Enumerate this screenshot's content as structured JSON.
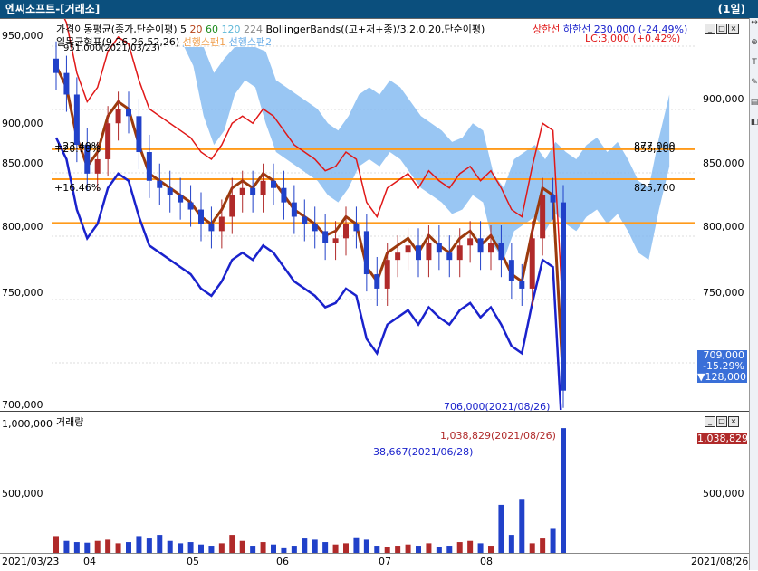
{
  "title": "엔씨소프트-[거래소]",
  "period": "(1일)",
  "legend": {
    "ma_label": "가격이동평균(종가,단순이평)",
    "ma_periods": [
      "5",
      "20",
      "60",
      "120",
      "224"
    ],
    "bb_label": "BollingerBands((고+저+종)/3,2,0,20,단순이평)",
    "upper_limit": "상한선",
    "lower_limit": "하한선",
    "change_info": "230,000 (-24.49%)",
    "ichimoku": "일목균형표(9,26,26,52,26)",
    "leading_span1": "선행스팬1",
    "leading_span2": "선행스팬2",
    "lc": "LC:3,000 (+0.42%)",
    "max_note": "951,000(2021/03/23)"
  },
  "price_axis": {
    "left": [
      "950,000",
      "900,000",
      "850,000",
      "800,000",
      "750,000",
      "700,000"
    ],
    "right": [
      "900,000",
      "850,000",
      "800,000",
      "750,000"
    ]
  },
  "hlines": [
    {
      "pct": "+23.40%",
      "value": "877,000",
      "price": 877000
    },
    {
      "pct": "+20.70%",
      "value": "856,100",
      "price": 856100
    },
    {
      "pct": "+16.46%",
      "value": "825,700",
      "price": 825700
    }
  ],
  "current": {
    "price": "709,000",
    "pct": "-15.29%",
    "change": "▼128,000"
  },
  "min_label": "706,000(2021/08/26)",
  "volume": {
    "title": "거래량",
    "axis": [
      "1,000,000",
      "500,000"
    ],
    "axis_right": [
      "500,000"
    ],
    "max_label": "1,038,829(2021/08/26)",
    "min_label": "38,667(2021/06/28)",
    "current": "1,038,829"
  },
  "dates": {
    "start": "2021/03/23",
    "end": "2021/08/26",
    "months": [
      "04",
      "05",
      "06",
      "07",
      "08"
    ]
  },
  "colors": {
    "up": "#b02a2a",
    "down": "#2141c9",
    "cloud": "#7fb8f0",
    "hline": "#ff9a1a",
    "bb_upper": "#e01818",
    "bb_lower": "#1a22cc",
    "ma20": "#9b3a0c"
  },
  "chart_data": {
    "type": "candlestick",
    "close_approx": [
      930000,
      915000,
      880000,
      860000,
      870000,
      895000,
      905000,
      900000,
      875000,
      855000,
      850000,
      845000,
      840000,
      835000,
      825000,
      820000,
      830000,
      845000,
      850000,
      845000,
      855000,
      850000,
      840000,
      830000,
      825000,
      820000,
      812000,
      815000,
      825000,
      820000,
      790000,
      780000,
      800000,
      805000,
      810000,
      800000,
      812000,
      805000,
      800000,
      810000,
      815000,
      805000,
      812000,
      800000,
      785000,
      780000,
      815000,
      845000,
      840000,
      709000
    ],
    "volume_approx": [
      140000,
      100000,
      90000,
      85000,
      100000,
      110000,
      80000,
      90000,
      140000,
      120000,
      150000,
      100000,
      80000,
      90000,
      70000,
      60000,
      80000,
      150000,
      100000,
      60000,
      90000,
      70000,
      38667,
      60000,
      120000,
      110000,
      90000,
      70000,
      80000,
      130000,
      110000,
      60000,
      50000,
      60000,
      70000,
      60000,
      80000,
      50000,
      60000,
      90000,
      100000,
      80000,
      60000,
      400000,
      150000,
      450000,
      80000,
      120000,
      200000,
      1038829
    ],
    "ylim": [
      700000,
      960000
    ]
  }
}
